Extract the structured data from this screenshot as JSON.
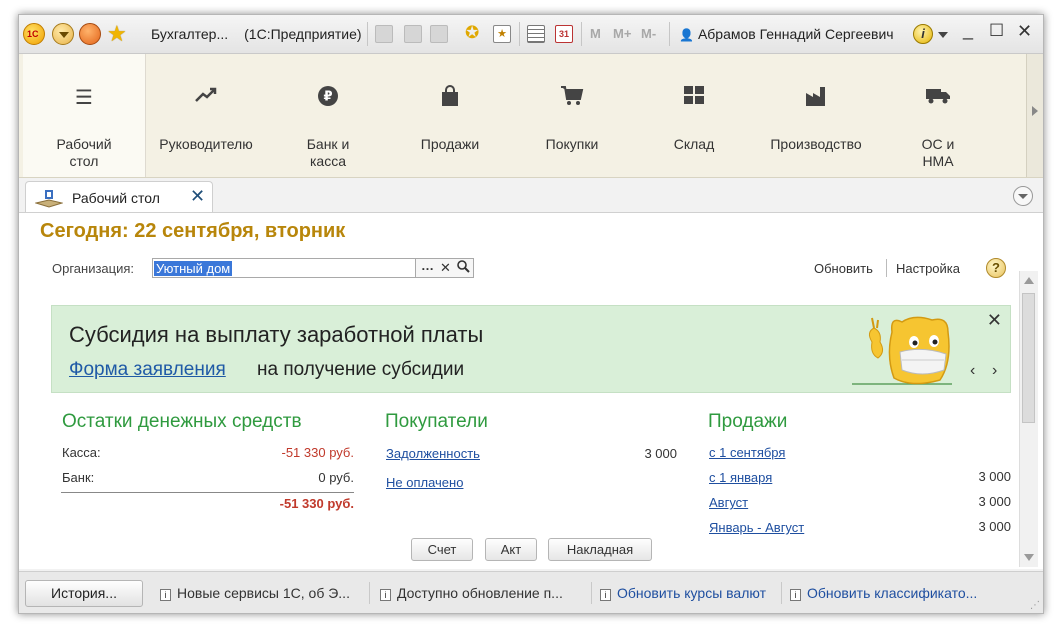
{
  "titlebar": {
    "app_title": "Бухгалтер...",
    "platform": "(1С:Предприятие)",
    "logo_text": "1С",
    "user_name": "Абрамов Геннадий Сергеевич",
    "m": "M",
    "m_plus": "M+",
    "m_minus": "M-"
  },
  "sections": [
    {
      "label": "Рабочий стол",
      "icon": "menu-lines-icon"
    },
    {
      "label": "Руководителю",
      "icon": "trend-chart-icon"
    },
    {
      "label": "Банк и касса",
      "icon": "ruble-coin-icon"
    },
    {
      "label": "Продажи",
      "icon": "shopping-bag-icon"
    },
    {
      "label": "Покупки",
      "icon": "cart-icon"
    },
    {
      "label": "Склад",
      "icon": "warehouse-grid-icon"
    },
    {
      "label": "Производство",
      "icon": "factory-icon"
    },
    {
      "label": "ОС и НМА",
      "icon": "truck-icon"
    }
  ],
  "tab": {
    "label": "Рабочий стол"
  },
  "content": {
    "today": "Сегодня: 22 сентября, вторник",
    "org_label": "Организация:",
    "org_value": "Уютный дом",
    "refresh": "Обновить",
    "settings": "Настройка",
    "banner": {
      "title": "Субсидия на выплату заработной платы",
      "link": "Форма заявления",
      "rest": "на получение субсидии"
    },
    "cash": {
      "title": "Остатки денежных средств",
      "rows": [
        {
          "label": "Касса:",
          "value": "-51 330 руб."
        },
        {
          "label": "Банк:",
          "value": "0 руб."
        }
      ],
      "total": "-51 330 руб."
    },
    "buyers": {
      "title": "Покупатели",
      "debt": "Задолженность",
      "debt_value": "3 000",
      "unpaid": "Не оплачено"
    },
    "sales": {
      "title": "Продажи",
      "rows": [
        {
          "label": "с 1 сентября",
          "value": ""
        },
        {
          "label": "с 1 января",
          "value": "3 000"
        },
        {
          "label": "Август",
          "value": "3 000"
        },
        {
          "label": "Январь - Август",
          "value": "3 000"
        }
      ]
    },
    "buttons": [
      "Счет",
      "Акт",
      "Накладная"
    ]
  },
  "bottombar": {
    "history": "История...",
    "notifications": [
      "Новые сервисы 1С, об Э...",
      "Доступно обновление п...",
      "Обновить курсы валют",
      "Обновить классификато..."
    ]
  },
  "colors": {
    "accent_gold": "#b8860b",
    "accent_green": "#2f9a3f",
    "link_blue": "#1f4fa0",
    "negative_red": "#c0392b",
    "banner_bg": "#d9efd8"
  }
}
